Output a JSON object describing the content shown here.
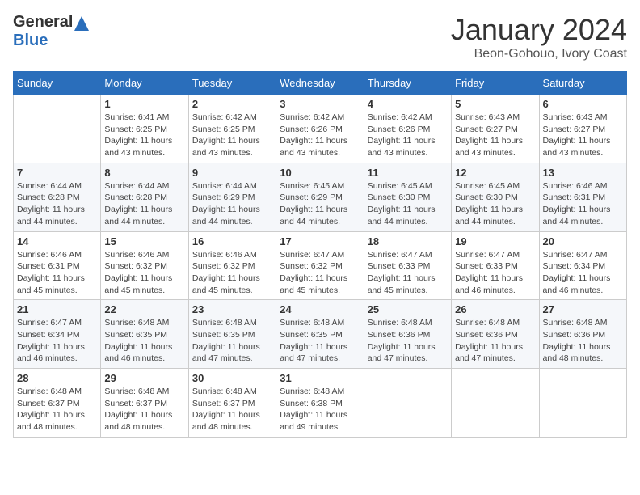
{
  "header": {
    "logo_general": "General",
    "logo_blue": "Blue",
    "month_title": "January 2024",
    "location": "Beon-Gohouo, Ivory Coast"
  },
  "days_of_week": [
    "Sunday",
    "Monday",
    "Tuesday",
    "Wednesday",
    "Thursday",
    "Friday",
    "Saturday"
  ],
  "weeks": [
    [
      {
        "day": "",
        "sunrise": "",
        "sunset": "",
        "daylight": ""
      },
      {
        "day": "1",
        "sunrise": "Sunrise: 6:41 AM",
        "sunset": "Sunset: 6:25 PM",
        "daylight": "Daylight: 11 hours and 43 minutes."
      },
      {
        "day": "2",
        "sunrise": "Sunrise: 6:42 AM",
        "sunset": "Sunset: 6:25 PM",
        "daylight": "Daylight: 11 hours and 43 minutes."
      },
      {
        "day": "3",
        "sunrise": "Sunrise: 6:42 AM",
        "sunset": "Sunset: 6:26 PM",
        "daylight": "Daylight: 11 hours and 43 minutes."
      },
      {
        "day": "4",
        "sunrise": "Sunrise: 6:42 AM",
        "sunset": "Sunset: 6:26 PM",
        "daylight": "Daylight: 11 hours and 43 minutes."
      },
      {
        "day": "5",
        "sunrise": "Sunrise: 6:43 AM",
        "sunset": "Sunset: 6:27 PM",
        "daylight": "Daylight: 11 hours and 43 minutes."
      },
      {
        "day": "6",
        "sunrise": "Sunrise: 6:43 AM",
        "sunset": "Sunset: 6:27 PM",
        "daylight": "Daylight: 11 hours and 43 minutes."
      }
    ],
    [
      {
        "day": "7",
        "sunrise": "Sunrise: 6:44 AM",
        "sunset": "Sunset: 6:28 PM",
        "daylight": "Daylight: 11 hours and 44 minutes."
      },
      {
        "day": "8",
        "sunrise": "Sunrise: 6:44 AM",
        "sunset": "Sunset: 6:28 PM",
        "daylight": "Daylight: 11 hours and 44 minutes."
      },
      {
        "day": "9",
        "sunrise": "Sunrise: 6:44 AM",
        "sunset": "Sunset: 6:29 PM",
        "daylight": "Daylight: 11 hours and 44 minutes."
      },
      {
        "day": "10",
        "sunrise": "Sunrise: 6:45 AM",
        "sunset": "Sunset: 6:29 PM",
        "daylight": "Daylight: 11 hours and 44 minutes."
      },
      {
        "day": "11",
        "sunrise": "Sunrise: 6:45 AM",
        "sunset": "Sunset: 6:30 PM",
        "daylight": "Daylight: 11 hours and 44 minutes."
      },
      {
        "day": "12",
        "sunrise": "Sunrise: 6:45 AM",
        "sunset": "Sunset: 6:30 PM",
        "daylight": "Daylight: 11 hours and 44 minutes."
      },
      {
        "day": "13",
        "sunrise": "Sunrise: 6:46 AM",
        "sunset": "Sunset: 6:31 PM",
        "daylight": "Daylight: 11 hours and 44 minutes."
      }
    ],
    [
      {
        "day": "14",
        "sunrise": "Sunrise: 6:46 AM",
        "sunset": "Sunset: 6:31 PM",
        "daylight": "Daylight: 11 hours and 45 minutes."
      },
      {
        "day": "15",
        "sunrise": "Sunrise: 6:46 AM",
        "sunset": "Sunset: 6:32 PM",
        "daylight": "Daylight: 11 hours and 45 minutes."
      },
      {
        "day": "16",
        "sunrise": "Sunrise: 6:46 AM",
        "sunset": "Sunset: 6:32 PM",
        "daylight": "Daylight: 11 hours and 45 minutes."
      },
      {
        "day": "17",
        "sunrise": "Sunrise: 6:47 AM",
        "sunset": "Sunset: 6:32 PM",
        "daylight": "Daylight: 11 hours and 45 minutes."
      },
      {
        "day": "18",
        "sunrise": "Sunrise: 6:47 AM",
        "sunset": "Sunset: 6:33 PM",
        "daylight": "Daylight: 11 hours and 45 minutes."
      },
      {
        "day": "19",
        "sunrise": "Sunrise: 6:47 AM",
        "sunset": "Sunset: 6:33 PM",
        "daylight": "Daylight: 11 hours and 46 minutes."
      },
      {
        "day": "20",
        "sunrise": "Sunrise: 6:47 AM",
        "sunset": "Sunset: 6:34 PM",
        "daylight": "Daylight: 11 hours and 46 minutes."
      }
    ],
    [
      {
        "day": "21",
        "sunrise": "Sunrise: 6:47 AM",
        "sunset": "Sunset: 6:34 PM",
        "daylight": "Daylight: 11 hours and 46 minutes."
      },
      {
        "day": "22",
        "sunrise": "Sunrise: 6:48 AM",
        "sunset": "Sunset: 6:35 PM",
        "daylight": "Daylight: 11 hours and 46 minutes."
      },
      {
        "day": "23",
        "sunrise": "Sunrise: 6:48 AM",
        "sunset": "Sunset: 6:35 PM",
        "daylight": "Daylight: 11 hours and 47 minutes."
      },
      {
        "day": "24",
        "sunrise": "Sunrise: 6:48 AM",
        "sunset": "Sunset: 6:35 PM",
        "daylight": "Daylight: 11 hours and 47 minutes."
      },
      {
        "day": "25",
        "sunrise": "Sunrise: 6:48 AM",
        "sunset": "Sunset: 6:36 PM",
        "daylight": "Daylight: 11 hours and 47 minutes."
      },
      {
        "day": "26",
        "sunrise": "Sunrise: 6:48 AM",
        "sunset": "Sunset: 6:36 PM",
        "daylight": "Daylight: 11 hours and 47 minutes."
      },
      {
        "day": "27",
        "sunrise": "Sunrise: 6:48 AM",
        "sunset": "Sunset: 6:36 PM",
        "daylight": "Daylight: 11 hours and 48 minutes."
      }
    ],
    [
      {
        "day": "28",
        "sunrise": "Sunrise: 6:48 AM",
        "sunset": "Sunset: 6:37 PM",
        "daylight": "Daylight: 11 hours and 48 minutes."
      },
      {
        "day": "29",
        "sunrise": "Sunrise: 6:48 AM",
        "sunset": "Sunset: 6:37 PM",
        "daylight": "Daylight: 11 hours and 48 minutes."
      },
      {
        "day": "30",
        "sunrise": "Sunrise: 6:48 AM",
        "sunset": "Sunset: 6:37 PM",
        "daylight": "Daylight: 11 hours and 48 minutes."
      },
      {
        "day": "31",
        "sunrise": "Sunrise: 6:48 AM",
        "sunset": "Sunset: 6:38 PM",
        "daylight": "Daylight: 11 hours and 49 minutes."
      },
      {
        "day": "",
        "sunrise": "",
        "sunset": "",
        "daylight": ""
      },
      {
        "day": "",
        "sunrise": "",
        "sunset": "",
        "daylight": ""
      },
      {
        "day": "",
        "sunrise": "",
        "sunset": "",
        "daylight": ""
      }
    ]
  ]
}
